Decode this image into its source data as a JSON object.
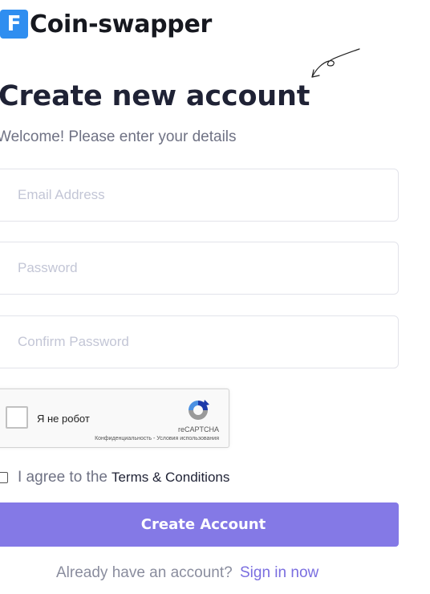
{
  "brand": {
    "logo_letter": "F",
    "name": "Coin-swapper",
    "accent": "#2f8ef0"
  },
  "heading": {
    "title": "Create new account",
    "subtitle": "Welcome! Please enter your details"
  },
  "form": {
    "email": {
      "placeholder": "Email Address",
      "value": ""
    },
    "password": {
      "placeholder": "Password",
      "value": ""
    },
    "confirm_password": {
      "placeholder": "Confirm Password",
      "value": ""
    }
  },
  "captcha": {
    "label": "Я не робот",
    "brand": "reCAPTCHA",
    "links": "Конфиденциальность - Условия использования",
    "checked": false
  },
  "agreement": {
    "text": "I agree to the",
    "link": "Terms & Conditions",
    "checked": false
  },
  "submit": {
    "label": "Create Account",
    "color": "#8479e6"
  },
  "signin": {
    "question": "Already have an account?",
    "link": "Sign in now"
  },
  "icons": [
    "hand-drawn-arrow-icon",
    "recaptcha-logo-icon",
    "checkbox-icon"
  ]
}
